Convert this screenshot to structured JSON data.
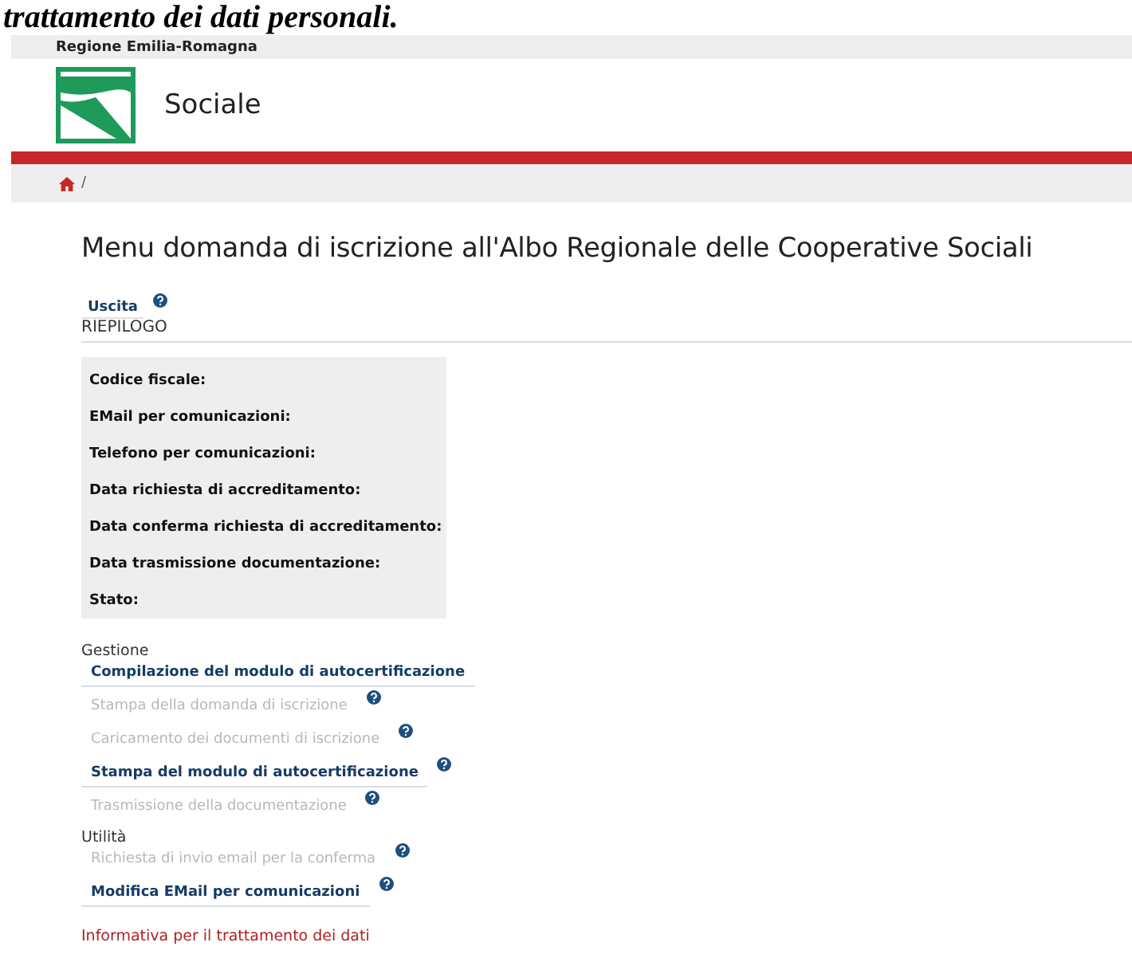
{
  "caption": "trattamento dei dati personali.",
  "top_bar": {
    "region": "Regione Emilia-Romagna"
  },
  "header": {
    "site": "Sociale"
  },
  "breadcrumb": {
    "separator": "/"
  },
  "title": "Menu domanda di iscrizione all'Albo Regionale delle Cooperative Sociali",
  "exit_link": {
    "label": "Uscita",
    "help": true
  },
  "summary": {
    "heading": "RIEPILOGO",
    "fields": [
      {
        "label": "Codice fiscale:"
      },
      {
        "label": "EMail per comunicazioni:"
      },
      {
        "label": "Telefono per comunicazioni:"
      },
      {
        "label": "Data richiesta di accreditamento:"
      },
      {
        "label": "Data conferma richiesta di accreditamento:"
      },
      {
        "label": "Data trasmissione documentazione:"
      },
      {
        "label": "Stato:"
      }
    ]
  },
  "sections": [
    {
      "heading": "Gestione",
      "items": [
        {
          "label": "Compilazione del modulo di autocertificazione",
          "disabled": false,
          "help": false
        },
        {
          "label": "Stampa della domanda di iscrizione",
          "disabled": true,
          "help": true
        },
        {
          "label": "Caricamento dei documenti di iscrizione",
          "disabled": true,
          "help": true
        },
        {
          "label": "Stampa del modulo di autocertificazione",
          "disabled": false,
          "help": true
        },
        {
          "label": "Trasmissione della documentazione",
          "disabled": true,
          "help": true
        }
      ]
    },
    {
      "heading": "Utilità",
      "items": [
        {
          "label": "Richiesta di invio email per la conferma",
          "disabled": true,
          "help": true
        },
        {
          "label": "Modifica EMail per comunicazioni",
          "disabled": false,
          "help": true
        }
      ]
    }
  ],
  "privacy_link": "Informativa per il trattamento dei dati"
}
